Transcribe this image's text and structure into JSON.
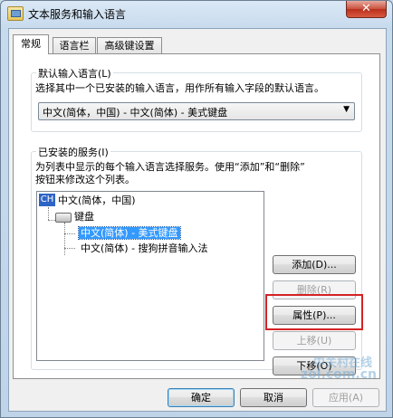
{
  "window": {
    "title": "文本服务和输入语言",
    "close_glyph": "✕"
  },
  "tabs": [
    {
      "label": "常规",
      "active": true
    },
    {
      "label": "语言栏",
      "active": false
    },
    {
      "label": "高级键设置",
      "active": false
    }
  ],
  "default_lang": {
    "group_title": "默认输入语言(L)",
    "description": "选择其中一个已安装的输入语言，用作所有输入字段的默认语言。",
    "selected": "中文(简体，中国) - 中文(简体) - 美式键盘",
    "arrow": "▼"
  },
  "installed": {
    "group_title": "已安装的服务(I)",
    "description_line1": "为列表中显示的每个输入语言选择服务。使用“添加”和“删除”",
    "description_line2": "按钮来修改这个列表。",
    "tree": {
      "lang_badge": "CH",
      "lang_label": "中文(简体，中国)",
      "category_label": "键盘",
      "items": [
        {
          "label": "中文(简体) - 美式键盘",
          "selected": true
        },
        {
          "label": "中文(简体) - 搜狗拼音输入法",
          "selected": false
        }
      ]
    },
    "buttons": {
      "add": "添加(D)...",
      "remove": "删除(R)",
      "properties": "属性(P)...",
      "move_up": "上移(U)",
      "move_down": "下移(O)"
    }
  },
  "footer": {
    "ok": "确定",
    "cancel": "取消",
    "apply": "应用(A)"
  },
  "watermark": {
    "line1": "中关村在线",
    "line2": "zol.com.cn"
  },
  "colors": {
    "selection": "#3399ff",
    "highlight_box": "#d32323",
    "close_button": "#c9503d"
  }
}
